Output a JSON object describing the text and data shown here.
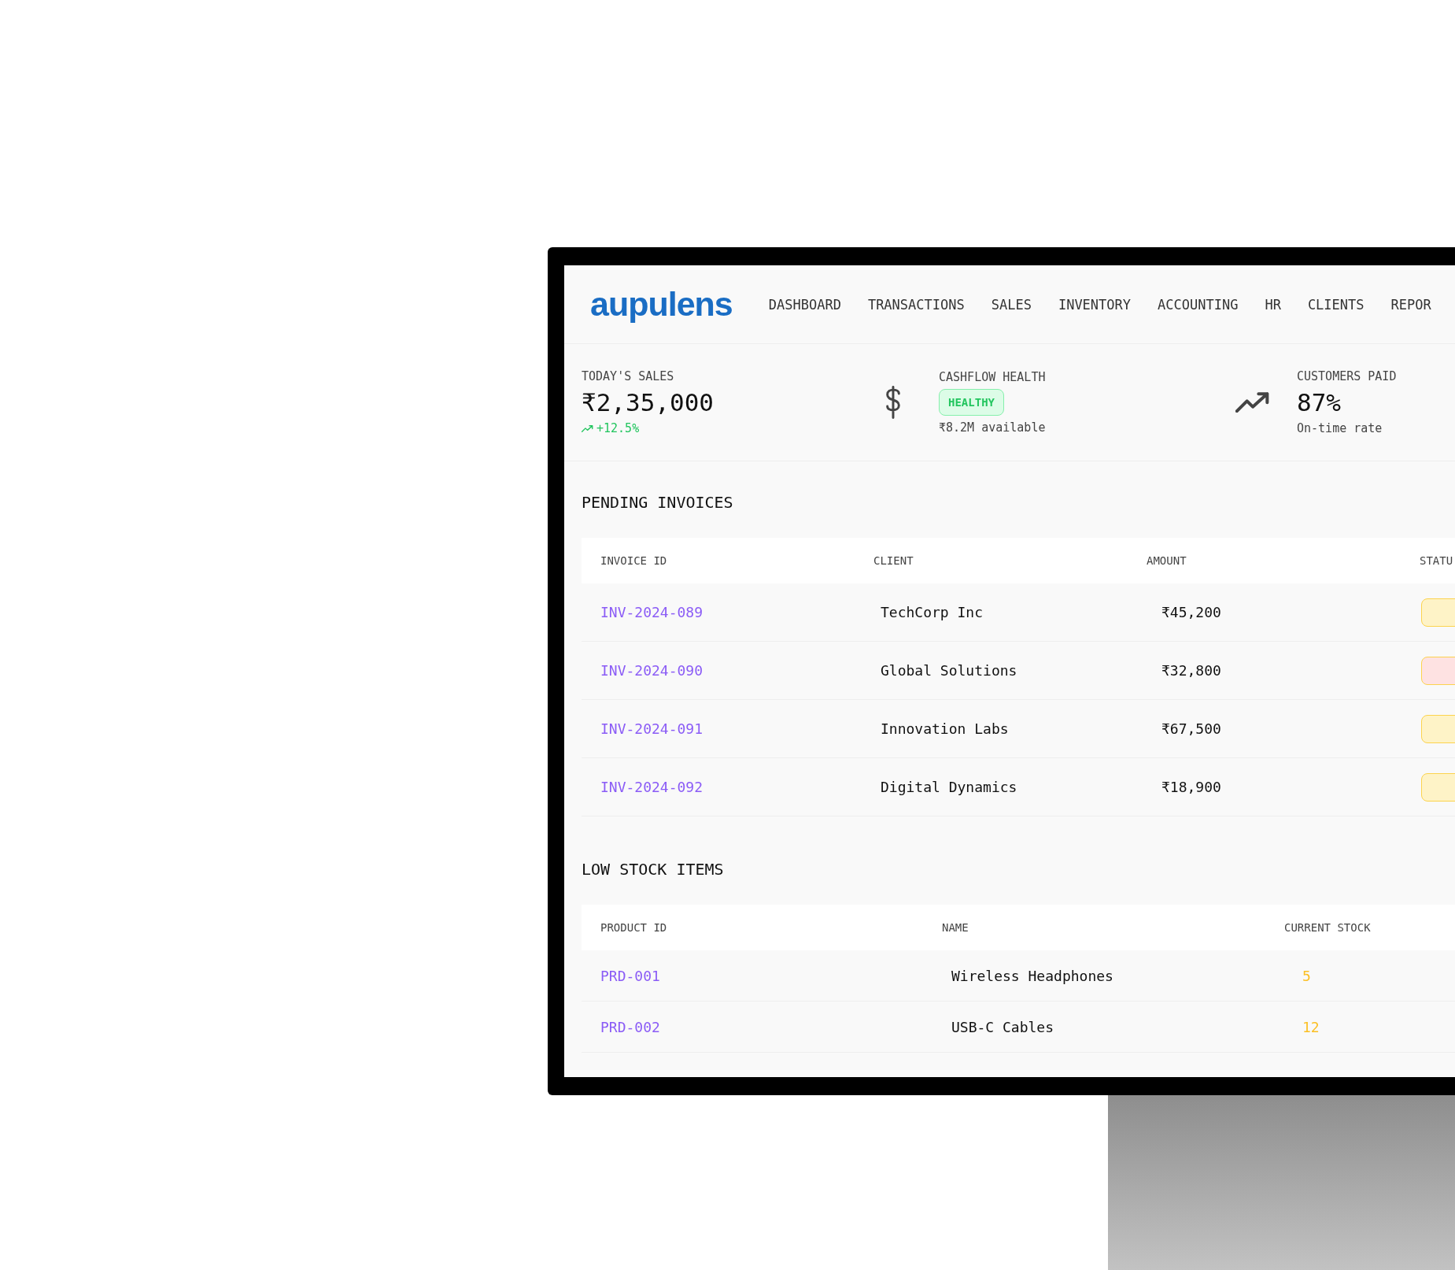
{
  "logo": {
    "text": "aupulens"
  },
  "nav": {
    "items": [
      {
        "label": "DASHBOARD"
      },
      {
        "label": "TRANSACTIONS"
      },
      {
        "label": "SALES"
      },
      {
        "label": "INVENTORY"
      },
      {
        "label": "ACCOUNTING"
      },
      {
        "label": "HR"
      },
      {
        "label": "CLIENTS"
      },
      {
        "label": "REPOR"
      }
    ]
  },
  "stats": [
    {
      "kind": "plain",
      "label": "TODAY'S SALES",
      "value": "₹2,35,000",
      "change": "+12.5%"
    },
    {
      "kind": "badge",
      "label": "CASHFLOW HEALTH",
      "badge": "HEALTHY",
      "note": "₹8.2M available"
    },
    {
      "kind": "value",
      "label": "CUSTOMERS PAID",
      "value": "87%",
      "note": "On-time rate"
    }
  ],
  "pending_invoices": {
    "title": "PENDING INVOICES",
    "columns": [
      "INVOICE ID",
      "CLIENT",
      "AMOUNT",
      "STATU"
    ],
    "rows": [
      {
        "id": "INV-2024-089",
        "client": "TechCorp Inc",
        "amount": "₹45,200",
        "color": "#fef3c7"
      },
      {
        "id": "INV-2024-090",
        "client": "Global Solutions",
        "amount": "₹32,800",
        "color": "#fee2e2"
      },
      {
        "id": "INV-2024-091",
        "client": "Innovation Labs",
        "amount": "₹67,500",
        "color": "#fef3c7"
      },
      {
        "id": "INV-2024-092",
        "client": "Digital Dynamics",
        "amount": "₹18,900",
        "color": "#fef3c7"
      }
    ]
  },
  "low_stock": {
    "title": "LOW STOCK ITEMS",
    "columns": [
      "PRODUCT ID",
      "NAME",
      "CURRENT STOCK"
    ],
    "rows": [
      {
        "id": "PRD-001",
        "name": "Wireless Headphones",
        "stock": "5"
      },
      {
        "id": "PRD-002",
        "name": "USB-C Cables",
        "stock": "12"
      }
    ]
  }
}
